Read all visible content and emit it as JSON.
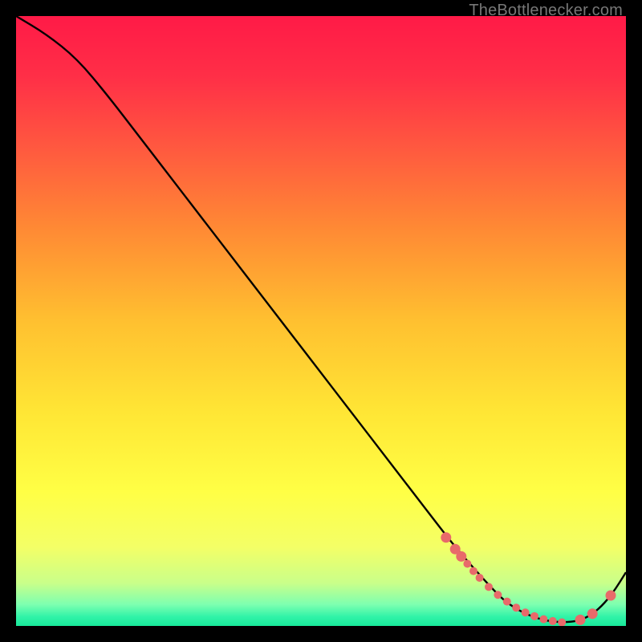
{
  "attribution": "TheBottlenecker.com",
  "colors": {
    "frame": "#000000",
    "line": "#000000",
    "marker": "#e86a6a",
    "gradient_stops": [
      {
        "offset": 0.0,
        "color": "#ff1a47"
      },
      {
        "offset": 0.1,
        "color": "#ff2f47"
      },
      {
        "offset": 0.22,
        "color": "#ff5a3f"
      },
      {
        "offset": 0.35,
        "color": "#ff8a34"
      },
      {
        "offset": 0.5,
        "color": "#ffc030"
      },
      {
        "offset": 0.65,
        "color": "#ffe635"
      },
      {
        "offset": 0.78,
        "color": "#ffff45"
      },
      {
        "offset": 0.87,
        "color": "#f4ff66"
      },
      {
        "offset": 0.93,
        "color": "#c9ff8a"
      },
      {
        "offset": 0.965,
        "color": "#7dffb0"
      },
      {
        "offset": 0.985,
        "color": "#30f3a8"
      },
      {
        "offset": 1.0,
        "color": "#18e89a"
      }
    ]
  },
  "chart_data": {
    "type": "line",
    "title": "",
    "xlabel": "",
    "ylabel": "",
    "xlim": [
      0,
      100
    ],
    "ylim": [
      0,
      100
    ],
    "grid": false,
    "legend": false,
    "series": [
      {
        "name": "bottleneck-curve",
        "x": [
          0,
          5,
          10,
          15,
          20,
          25,
          30,
          35,
          40,
          45,
          50,
          55,
          60,
          65,
          70,
          72,
          75,
          78,
          80,
          82,
          84,
          86,
          88,
          90,
          92,
          94,
          96,
          98,
          100
        ],
        "y": [
          100,
          97,
          93,
          87,
          80.5,
          74,
          67.5,
          61,
          54.5,
          48,
          41.5,
          35,
          28.5,
          22,
          15.5,
          13,
          9.5,
          6.2,
          4.2,
          2.8,
          1.8,
          1.1,
          0.7,
          0.6,
          0.8,
          1.6,
          3.2,
          5.6,
          8.8
        ]
      }
    ],
    "markers": {
      "name": "highlight-dots",
      "x": [
        70.5,
        72,
        73,
        74,
        75,
        76,
        77.5,
        79,
        80.5,
        82,
        83.5,
        85,
        86.5,
        88,
        89.5,
        92.5,
        94.5,
        97.5
      ],
      "y": [
        14.5,
        12.6,
        11.4,
        10.2,
        9.0,
        7.9,
        6.4,
        5.1,
        4.0,
        3.0,
        2.2,
        1.6,
        1.1,
        0.8,
        0.6,
        1.0,
        2.0,
        5.0
      ]
    }
  }
}
